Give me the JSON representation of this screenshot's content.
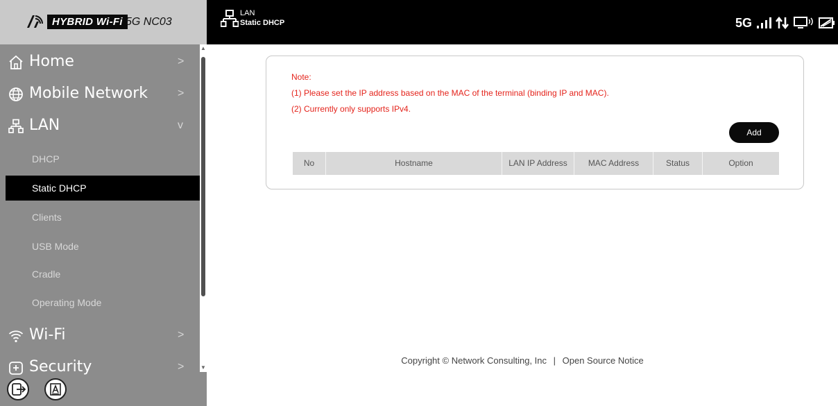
{
  "brand": {
    "name": "HYBRID Wi-Fi",
    "model": "5G NC03"
  },
  "sidebar": {
    "items": [
      {
        "label": "Home",
        "icon": "home-icon",
        "chevron": ">"
      },
      {
        "label": "Mobile Network",
        "icon": "globe-icon",
        "chevron": ">"
      },
      {
        "label": "LAN",
        "icon": "lan-icon",
        "chevron": "v"
      }
    ],
    "lan_subitems": [
      "DHCP",
      "Static DHCP",
      "Clients",
      "USB Mode",
      "Cradle",
      "Operating Mode"
    ],
    "active_subitem": "Static DHCP",
    "lower_items": [
      {
        "label": "Wi-Fi",
        "icon": "wifi-icon",
        "chevron": ">"
      },
      {
        "label": "Security",
        "icon": "security-icon",
        "chevron": ">"
      }
    ],
    "bottom_icons": [
      "logout-icon",
      "font-size-icon"
    ]
  },
  "header": {
    "breadcrumb_parent": "LAN",
    "breadcrumb_current": "Static DHCP",
    "network_type": "5G",
    "status_icons": [
      "signal-bars-icon",
      "data-transfer-icon",
      "connected-device-icon",
      "battery-icon"
    ]
  },
  "content": {
    "note_title": "Note:",
    "note_1": "(1) Please set the IP address based on the MAC of the terminal (binding IP and MAC).",
    "note_2": "(2) Currently only supports IPv4.",
    "add_label": "Add",
    "columns": [
      "No",
      "Hostname",
      "LAN IP Address",
      "MAC Address",
      "Status",
      "Option"
    ]
  },
  "footer": {
    "copyright": "Copyright © Network Consulting, Inc",
    "separator": "|",
    "link": "Open Source Notice"
  },
  "colors": {
    "note": "#e4231b",
    "header_bg": "#000000",
    "sidebar_bg": "#8c8c8c",
    "active_bg": "#000000"
  }
}
